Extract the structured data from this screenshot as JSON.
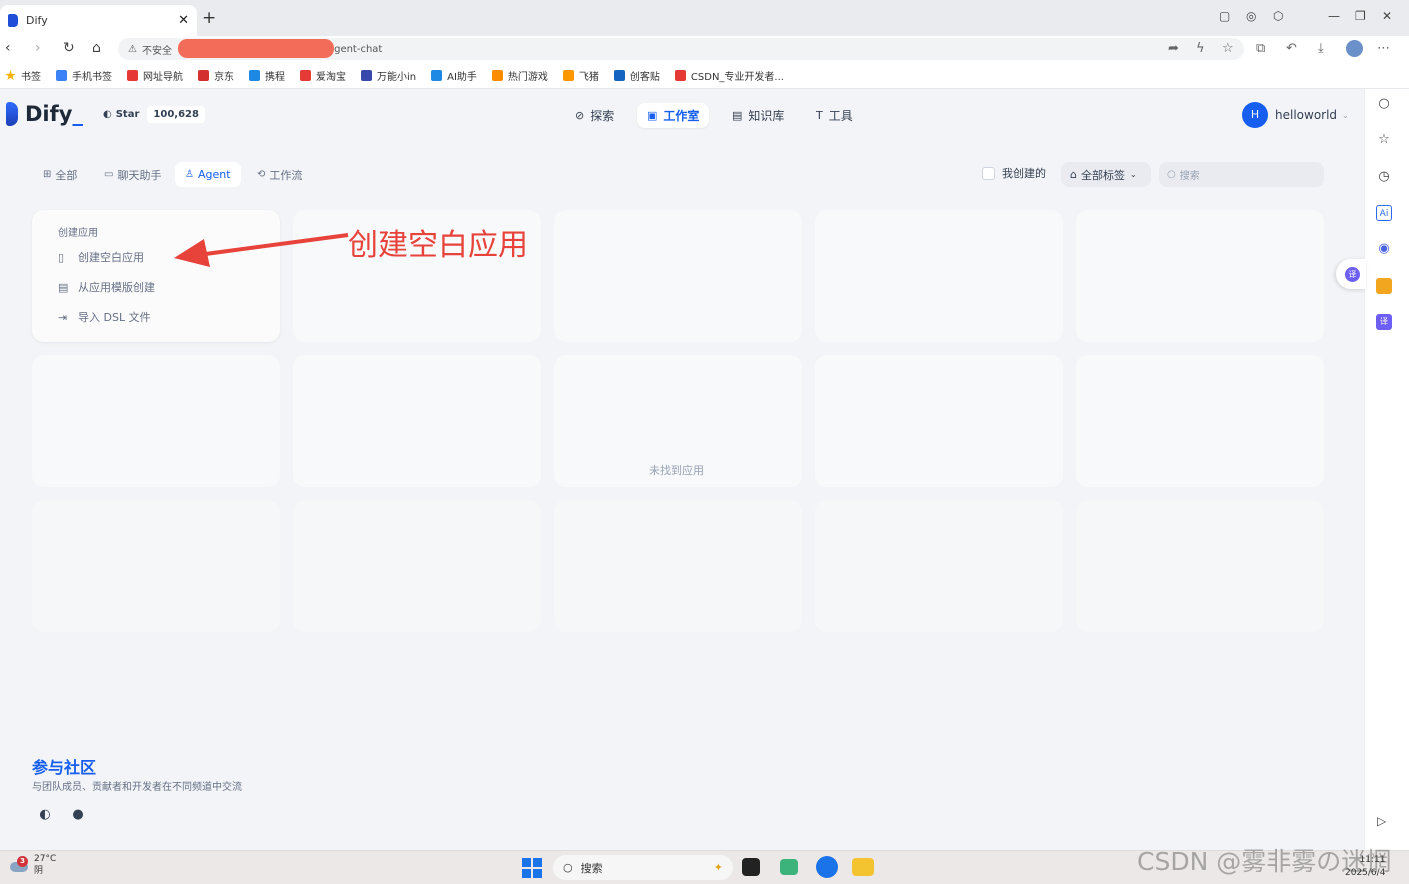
{
  "browser": {
    "tab_title": "Dify",
    "address_insecure": "不安全",
    "address_url_suffix": "agent-chat",
    "bookmarks": [
      {
        "label": "书签",
        "color": "#f5b400"
      },
      {
        "label": "手机书签",
        "color": "#3b82f6"
      },
      {
        "label": "网址导航",
        "color": "#e53935"
      },
      {
        "label": "京东",
        "color": "#d32f2f"
      },
      {
        "label": "携程",
        "color": "#1e88e5"
      },
      {
        "label": "爱淘宝",
        "color": "#e53935"
      },
      {
        "label": "万能小in",
        "color": "#3949ab"
      },
      {
        "label": "AI助手",
        "color": "#1e88e5"
      },
      {
        "label": "热门游戏",
        "color": "#fb8c00"
      },
      {
        "label": "飞猪",
        "color": "#ff9800"
      },
      {
        "label": "创客贴",
        "color": "#1565c0"
      },
      {
        "label": "CSDN_专业开发者...",
        "color": "#e53935"
      }
    ]
  },
  "header": {
    "logo_text": "Dify",
    "star_label": "Star",
    "star_count": "100,628",
    "nav": [
      {
        "label": "探索",
        "icon": "compass-icon"
      },
      {
        "label": "工作室",
        "icon": "robot-icon",
        "active": true
      },
      {
        "label": "知识库",
        "icon": "book-icon"
      },
      {
        "label": "工具",
        "icon": "hammer-icon"
      }
    ],
    "user_initial": "H",
    "user_name": "helloworld"
  },
  "filters": {
    "tabs": [
      {
        "label": "全部",
        "icon": "grid-icon"
      },
      {
        "label": "聊天助手",
        "icon": "chat-icon"
      },
      {
        "label": "Agent",
        "icon": "agent-icon",
        "active": true
      },
      {
        "label": "工作流",
        "icon": "workflow-icon"
      }
    ],
    "mine_label": "我创建的",
    "tag_label": "全部标签",
    "search_placeholder": "搜索"
  },
  "create_card": {
    "title": "创建应用",
    "options": [
      {
        "label": "创建空白应用",
        "icon": "blank-file-icon"
      },
      {
        "label": "从应用模版创建",
        "icon": "template-icon"
      },
      {
        "label": "导入 DSL 文件",
        "icon": "import-icon"
      }
    ]
  },
  "empty_note": "未找到应用",
  "annotation": "创建空白应用",
  "community": {
    "title": "参与社区",
    "description": "与团队成员、贡献者和开发者在不同频道中交流"
  },
  "taskbar": {
    "weather_temp": "27°C",
    "weather_desc": "阴",
    "weather_badge": "3",
    "search_label": "搜索",
    "time": "11:11",
    "date": "2025/6/4",
    "watermark": "CSDN @雾非雾の迷惘"
  },
  "colors": {
    "accent": "#155eef",
    "annotation": "#e8433b",
    "page_bg": "#f2f4f7"
  }
}
